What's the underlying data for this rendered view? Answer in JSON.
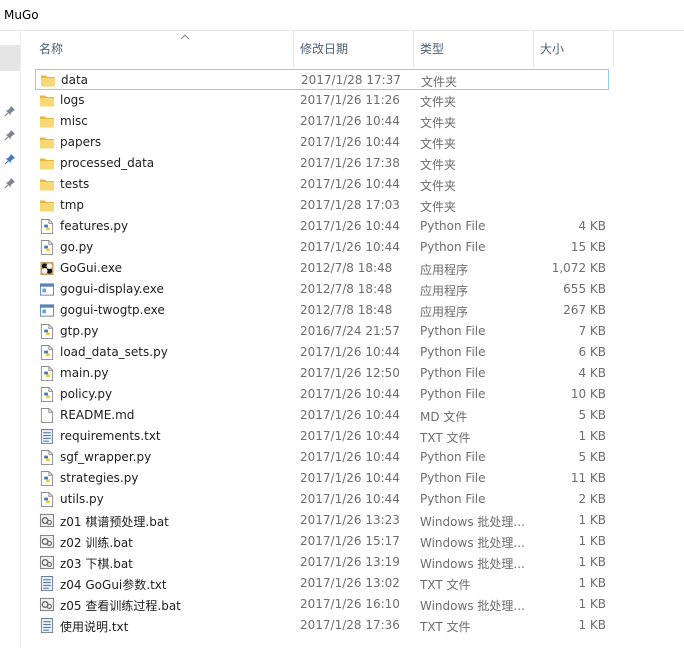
{
  "window": {
    "title": "MuGo"
  },
  "columns": [
    {
      "key": "name",
      "label": "名称"
    },
    {
      "key": "date",
      "label": "修改日期"
    },
    {
      "key": "type",
      "label": "类型"
    },
    {
      "key": "size",
      "label": "大小"
    }
  ],
  "sort": {
    "column": "name",
    "direction": "ascending"
  },
  "colors": {
    "folder": "#f0c452",
    "python_blue": "#3f7cb5",
    "python_yellow": "#f5cb3c",
    "selection_border": "#99c9ef"
  },
  "files": [
    {
      "name": "data",
      "date": "2017/1/28 17:37",
      "type": "文件夹",
      "size": "",
      "icon": "folder-icon"
    },
    {
      "name": "logs",
      "date": "2017/1/26 11:26",
      "type": "文件夹",
      "size": "",
      "icon": "folder-icon"
    },
    {
      "name": "misc",
      "date": "2017/1/26 10:44",
      "type": "文件夹",
      "size": "",
      "icon": "folder-icon"
    },
    {
      "name": "papers",
      "date": "2017/1/26 10:44",
      "type": "文件夹",
      "size": "",
      "icon": "folder-icon"
    },
    {
      "name": "processed_data",
      "date": "2017/1/26 17:38",
      "type": "文件夹",
      "size": "",
      "icon": "folder-icon"
    },
    {
      "name": "tests",
      "date": "2017/1/26 10:44",
      "type": "文件夹",
      "size": "",
      "icon": "folder-icon"
    },
    {
      "name": "tmp",
      "date": "2017/1/28 17:03",
      "type": "文件夹",
      "size": "",
      "icon": "folder-icon"
    },
    {
      "name": "features.py",
      "date": "2017/1/26 10:44",
      "type": "Python File",
      "size": "4 KB",
      "icon": "python-file-icon"
    },
    {
      "name": "go.py",
      "date": "2017/1/26 10:44",
      "type": "Python File",
      "size": "15 KB",
      "icon": "python-file-icon"
    },
    {
      "name": "GoGui.exe",
      "date": "2012/7/8 18:48",
      "type": "应用程序",
      "size": "1,072 KB",
      "icon": "gogui-app-icon"
    },
    {
      "name": "gogui-display.exe",
      "date": "2012/7/8 18:48",
      "type": "应用程序",
      "size": "655 KB",
      "icon": "exe-window-icon"
    },
    {
      "name": "gogui-twogtp.exe",
      "date": "2012/7/8 18:48",
      "type": "应用程序",
      "size": "267 KB",
      "icon": "exe-window-icon"
    },
    {
      "name": "gtp.py",
      "date": "2016/7/24 21:57",
      "type": "Python File",
      "size": "7 KB",
      "icon": "python-file-icon"
    },
    {
      "name": "load_data_sets.py",
      "date": "2017/1/26 10:44",
      "type": "Python File",
      "size": "6 KB",
      "icon": "python-file-icon"
    },
    {
      "name": "main.py",
      "date": "2017/1/26 12:50",
      "type": "Python File",
      "size": "4 KB",
      "icon": "python-file-icon"
    },
    {
      "name": "policy.py",
      "date": "2017/1/26 10:44",
      "type": "Python File",
      "size": "10 KB",
      "icon": "python-file-icon"
    },
    {
      "name": "README.md",
      "date": "2017/1/26 10:44",
      "type": "MD 文件",
      "size": "5 KB",
      "icon": "blank-file-icon"
    },
    {
      "name": "requirements.txt",
      "date": "2017/1/26 10:44",
      "type": "TXT 文件",
      "size": "1 KB",
      "icon": "text-file-icon"
    },
    {
      "name": "sgf_wrapper.py",
      "date": "2017/1/26 10:44",
      "type": "Python File",
      "size": "5 KB",
      "icon": "python-file-icon"
    },
    {
      "name": "strategies.py",
      "date": "2017/1/26 10:44",
      "type": "Python File",
      "size": "11 KB",
      "icon": "python-file-icon"
    },
    {
      "name": "utils.py",
      "date": "2017/1/26 10:44",
      "type": "Python File",
      "size": "2 KB",
      "icon": "python-file-icon"
    },
    {
      "name": "z01 棋谱预处理.bat",
      "date": "2017/1/26 13:23",
      "type": "Windows 批处理...",
      "size": "1 KB",
      "icon": "batch-file-icon"
    },
    {
      "name": "z02 训练.bat",
      "date": "2017/1/26 15:17",
      "type": "Windows 批处理...",
      "size": "1 KB",
      "icon": "batch-file-icon"
    },
    {
      "name": "z03 下棋.bat",
      "date": "2017/1/26 13:19",
      "type": "Windows 批处理...",
      "size": "1 KB",
      "icon": "batch-file-icon"
    },
    {
      "name": "z04 GoGui参数.txt",
      "date": "2017/1/26 13:02",
      "type": "TXT 文件",
      "size": "1 KB",
      "icon": "text-file-icon"
    },
    {
      "name": "z05 查看训练过程.bat",
      "date": "2017/1/26 16:10",
      "type": "Windows 批处理...",
      "size": "1 KB",
      "icon": "batch-file-icon"
    },
    {
      "name": "使用说明.txt",
      "date": "2017/1/28 17:36",
      "type": "TXT 文件",
      "size": "1 KB",
      "icon": "text-file-icon"
    }
  ]
}
